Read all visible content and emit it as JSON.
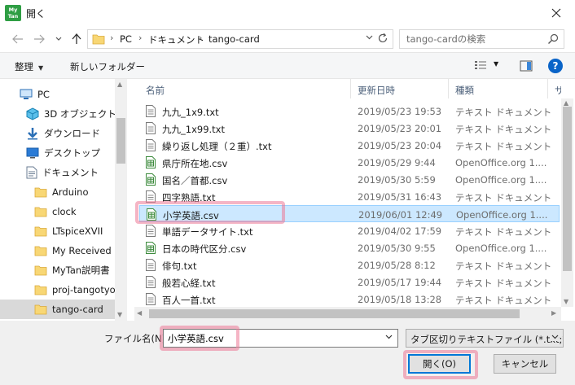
{
  "window": {
    "title": "開く",
    "app_icon_text_top": "My",
    "app_icon_text_bottom": "Tan"
  },
  "address": {
    "crumbs": [
      "PC",
      "ドキュメント",
      "tango-card"
    ],
    "search_placeholder": "tango-cardの検索"
  },
  "toolbar": {
    "organize_label": "整理",
    "new_folder_label": "新しいフォルダー"
  },
  "nav_pane": {
    "items": [
      {
        "label": "PC",
        "icon": "pc-icon"
      },
      {
        "label": "3D オブジェクト",
        "icon": "3d-objects-icon"
      },
      {
        "label": "ダウンロード",
        "icon": "download-icon"
      },
      {
        "label": "デスクトップ",
        "icon": "desktop-icon"
      },
      {
        "label": "ドキュメント",
        "icon": "documents-icon"
      },
      {
        "label": "Arduino",
        "icon": "folder-icon"
      },
      {
        "label": "clock",
        "icon": "folder-icon"
      },
      {
        "label": "LTspiceXVII",
        "icon": "folder-icon"
      },
      {
        "label": "My Received Pr",
        "icon": "folder-icon"
      },
      {
        "label": "MyTan説明書",
        "icon": "folder-icon"
      },
      {
        "label": "proj-tangotyou",
        "icon": "folder-icon"
      },
      {
        "label": "tango-card",
        "icon": "folder-icon"
      }
    ],
    "selected_index": 11
  },
  "file_list": {
    "columns": [
      "名前",
      "更新日時",
      "種類",
      "サ"
    ],
    "rows": [
      {
        "name": "九九_1x9.txt",
        "date": "2019/05/23 19:53",
        "type": "テキスト ドキュメント",
        "icon": "text-file-icon"
      },
      {
        "name": "九九_1x99.txt",
        "date": "2019/05/23 20:01",
        "type": "テキスト ドキュメント",
        "icon": "text-file-icon"
      },
      {
        "name": "繰り返し処理（２重）.txt",
        "date": "2019/05/23 20:04",
        "type": "テキスト ドキュメント",
        "icon": "text-file-icon"
      },
      {
        "name": "県庁所在地.csv",
        "date": "2019/05/29 9:44",
        "type": "OpenOffice.org 1....",
        "icon": "csv-file-icon"
      },
      {
        "name": "国名／首都.csv",
        "date": "2019/05/30 5:59",
        "type": "OpenOffice.org 1....",
        "icon": "csv-file-icon"
      },
      {
        "name": "四字熟語.txt",
        "date": "2019/05/31 16:43",
        "type": "テキスト ドキュメント",
        "icon": "text-file-icon"
      },
      {
        "name": "小学英語.csv",
        "date": "2019/06/01 12:49",
        "type": "OpenOffice.org 1....",
        "icon": "csv-file-icon"
      },
      {
        "name": "単語データサイト.txt",
        "date": "2019/04/02 17:59",
        "type": "テキスト ドキュメント",
        "icon": "text-file-icon"
      },
      {
        "name": "日本の時代区分.csv",
        "date": "2019/05/30 9:55",
        "type": "OpenOffice.org 1....",
        "icon": "csv-file-icon"
      },
      {
        "name": "俳句.txt",
        "date": "2019/05/28 8:12",
        "type": "テキスト ドキュメント",
        "icon": "text-file-icon"
      },
      {
        "name": "般若心経.txt",
        "date": "2019/05/17 19:44",
        "type": "テキスト ドキュメント",
        "icon": "text-file-icon"
      },
      {
        "name": "百人一首.txt",
        "date": "2019/05/18 13:28",
        "type": "テキスト ドキュメント",
        "icon": "text-file-icon"
      }
    ],
    "selected_index": 6
  },
  "bottom": {
    "filename_label": "ファイル名(N):",
    "filename_value": "小学英語.csv",
    "filetype_value": "タブ区切りテキストファイル (*.txt;*.csv)",
    "open_label": "開く(O)",
    "cancel_label": "キャンセル"
  },
  "colors": {
    "selection_bg": "#cce8ff",
    "selection_border": "#99d1ff",
    "highlight": "#ec7896",
    "accent": "#0078d7"
  }
}
